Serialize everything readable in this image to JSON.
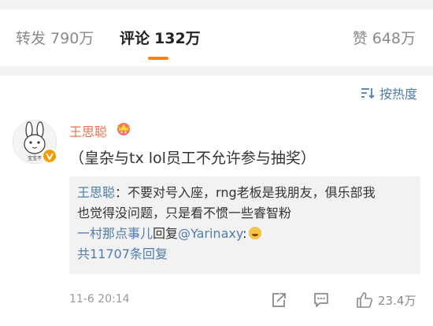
{
  "tabs": {
    "repost_label": "转发",
    "repost_count": "790万",
    "comments_label": "评论",
    "comments_count": "132万",
    "likes_label": "赞",
    "likes_count": "648万"
  },
  "sort": {
    "label": "按热度",
    "icon": "sort-icon"
  },
  "comment": {
    "username": "王思聪",
    "avatar_caption": "宝宝不",
    "text": "（皇杂与tx lol员工不允许参与抽奖）",
    "reply": {
      "first_author": "王思聪",
      "first_text_line1": "：不要对号入座，rng老板是我朋友，俱乐部我",
      "first_text_line2": "也觉得没问题，只是看不惯一些睿智粉",
      "second_author": "一村那点事儿",
      "second_text_prefix": "回复",
      "second_mention": "@Yarinaxy",
      "second_text_suffix": ":",
      "total": "共11707条回复"
    },
    "timestamp": "11-6 20:14",
    "like_count": "23.4万"
  },
  "colors": {
    "accent": "#ff8200",
    "link": "#507daf",
    "username": "#eb7350",
    "verified": "#f59b00",
    "panel_bg": "#f2f2f2"
  }
}
